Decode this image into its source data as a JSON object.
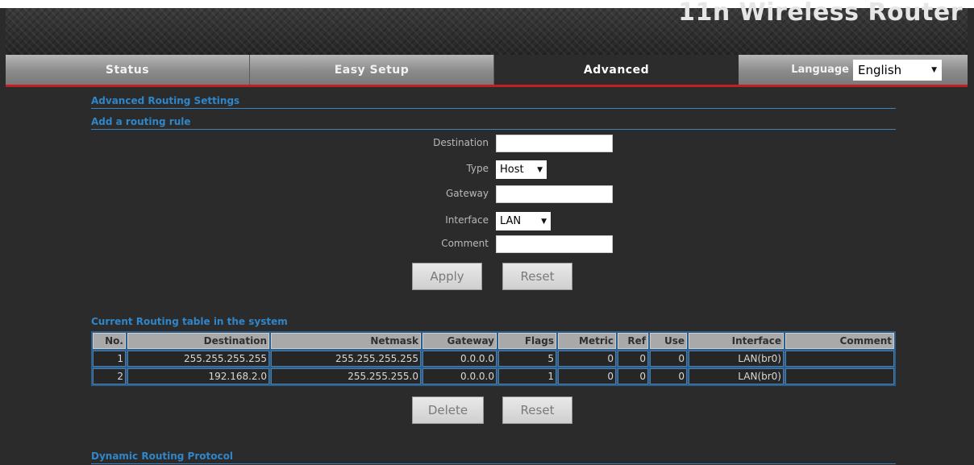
{
  "header": {
    "brand": "11n Wireless Router"
  },
  "nav": {
    "tabs": [
      {
        "label": "Status",
        "active": false
      },
      {
        "label": "Easy Setup",
        "active": false
      },
      {
        "label": "Advanced",
        "active": true
      }
    ],
    "language_label": "Language",
    "language_value": "English"
  },
  "sections": {
    "advanced_routing": "Advanced Routing Settings",
    "add_rule": "Add a routing rule",
    "current_table": "Current Routing table in the system",
    "dynamic": "Dynamic Routing Protocol"
  },
  "form": {
    "destination_label": "Destination",
    "destination_value": "",
    "type_label": "Type",
    "type_value": "Host",
    "gateway_label": "Gateway",
    "gateway_value": "",
    "interface_label": "Interface",
    "interface_value": "LAN",
    "comment_label": "Comment",
    "comment_value": "",
    "apply_label": "Apply",
    "reset_label": "Reset"
  },
  "routing_table": {
    "headers": [
      "No.",
      "Destination",
      "Netmask",
      "Gateway",
      "Flags",
      "Metric",
      "Ref",
      "Use",
      "Interface",
      "Comment"
    ],
    "rows": [
      [
        "1",
        "255.255.255.255",
        "255.255.255.255",
        "0.0.0.0",
        "5",
        "0",
        "0",
        "0",
        "LAN(br0)",
        ""
      ],
      [
        "2",
        "192.168.2.0",
        "255.255.255.0",
        "0.0.0.0",
        "1",
        "0",
        "0",
        "0",
        "LAN(br0)",
        ""
      ]
    ],
    "delete_label": "Delete",
    "reset_label": "Reset"
  },
  "colors": {
    "accent_red": "#c21f25",
    "section_blue": "#2f86c9",
    "background": "#2b2b2b"
  }
}
